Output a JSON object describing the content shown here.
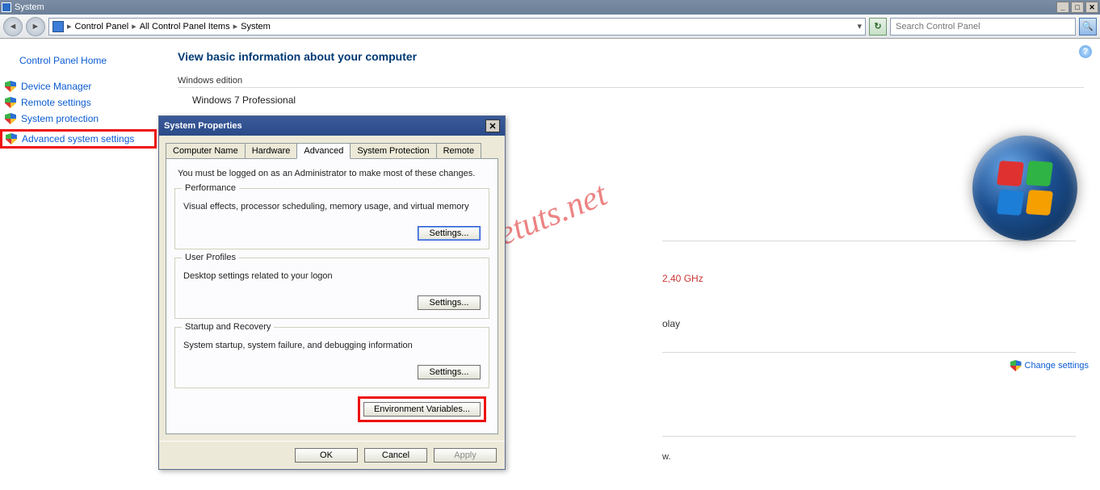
{
  "window": {
    "title": "System"
  },
  "toolbar": {
    "breadcrumb": [
      "Control Panel",
      "All Control Panel Items",
      "System"
    ],
    "search_placeholder": "Search Control Panel"
  },
  "sidebar": {
    "home": "Control Panel Home",
    "items": [
      {
        "label": "Device Manager"
      },
      {
        "label": "Remote settings"
      },
      {
        "label": "System protection"
      },
      {
        "label": "Advanced system settings"
      }
    ]
  },
  "main": {
    "heading": "View basic information about your computer",
    "edition_section": "Windows edition",
    "edition_value": "Windows 7 Professional",
    "cpu_snippet": "2,40 GHz",
    "display_snippet": "olay",
    "trailing_snippet": "w.",
    "change_settings": "Change settings",
    "help_glyph": "?"
  },
  "dialog": {
    "title": "System Properties",
    "tabs": [
      "Computer Name",
      "Hardware",
      "Advanced",
      "System Protection",
      "Remote"
    ],
    "active_tab_index": 2,
    "panel_intro": "You must be logged on as an Administrator to make most of these changes.",
    "groups": {
      "performance": {
        "legend": "Performance",
        "desc": "Visual effects, processor scheduling, memory usage, and virtual memory",
        "button": "Settings..."
      },
      "profiles": {
        "legend": "User Profiles",
        "desc": "Desktop settings related to your logon",
        "button": "Settings..."
      },
      "startup": {
        "legend": "Startup and Recovery",
        "desc": "System startup, system failure, and debugging information",
        "button": "Settings..."
      }
    },
    "env_button": "Environment Variables...",
    "footer": {
      "ok": "OK",
      "cancel": "Cancel",
      "apply": "Apply"
    }
  },
  "watermark": "freetuts.net",
  "icons": {
    "back": "◄",
    "forward": "►",
    "refresh": "↻",
    "search": "🔍",
    "close": "✕",
    "dropdown": "▾",
    "sep": "▸"
  }
}
